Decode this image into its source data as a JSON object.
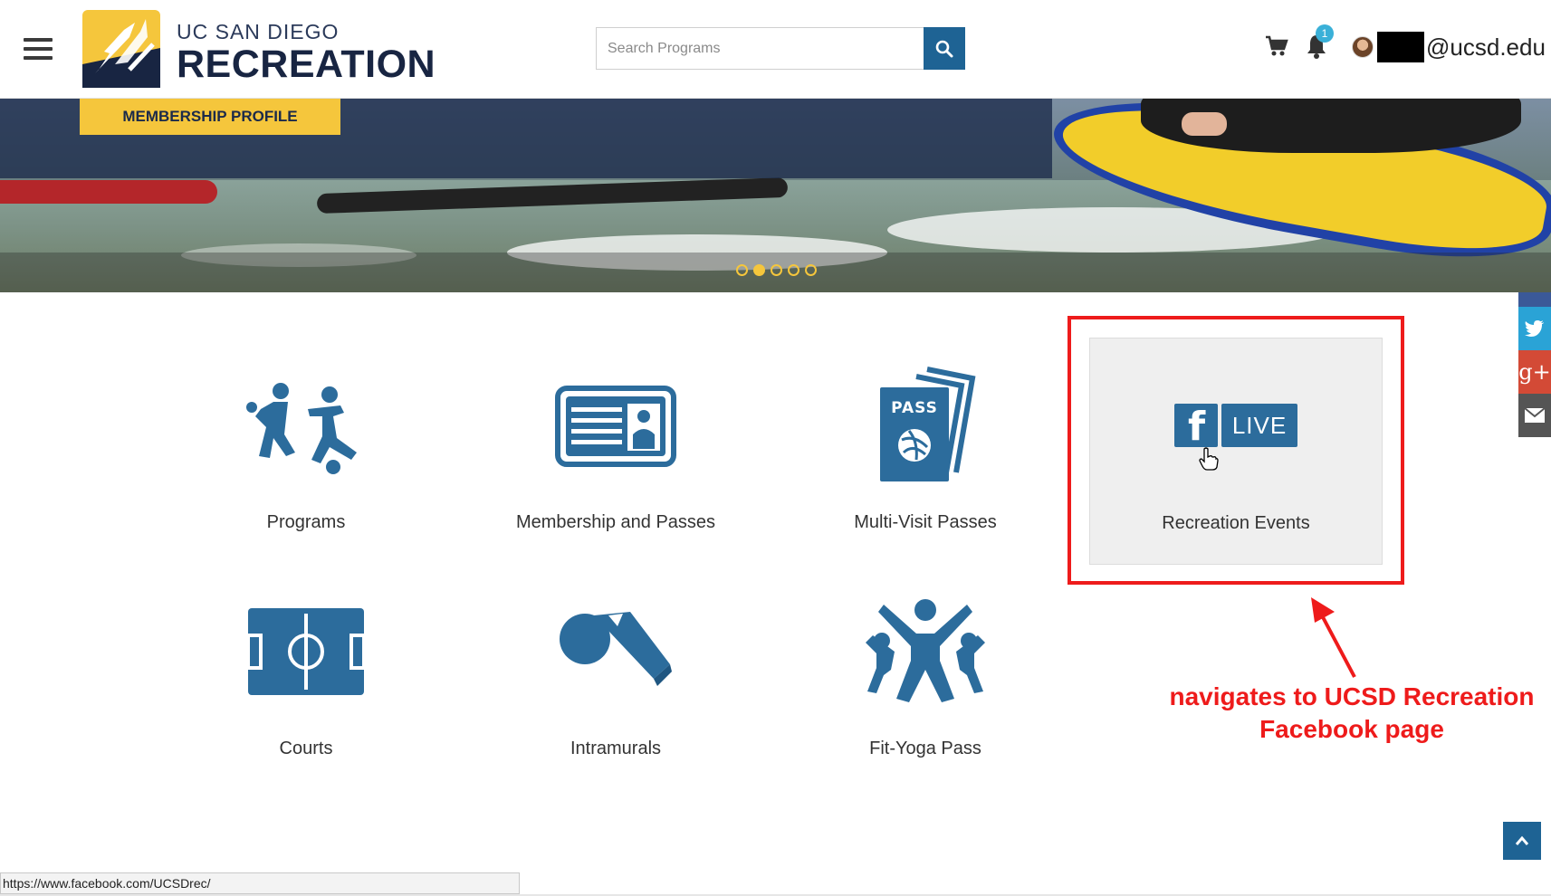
{
  "header": {
    "brand_top": "UC SAN DIEGO",
    "brand_main": "RECREATION",
    "search_placeholder": "Search Programs",
    "notification_count": "1",
    "user_email_suffix": "@ucsd.edu"
  },
  "hero": {
    "membership_button": "MEMBERSHIP PROFILE",
    "carousel_slides": 5,
    "active_slide": 2
  },
  "tiles": [
    {
      "label": "Programs"
    },
    {
      "label": "Membership and Passes"
    },
    {
      "label": "Multi-Visit Passes"
    },
    {
      "label": "Recreation Events"
    },
    {
      "label": "Courts"
    },
    {
      "label": "Intramurals"
    },
    {
      "label": "Fit-Yoga Pass"
    }
  ],
  "pass_icon_text": "PASS",
  "fb_live_text": "LIVE",
  "annotation": {
    "line1": "navigates to UCSD Recreation",
    "line2": "Facebook page"
  },
  "status_bar_url": "https://www.facebook.com/UCSDrec/",
  "colors": {
    "brand_blue": "#1e6394",
    "icon_blue": "#2c6c9c",
    "accent_yellow": "#f5c63c",
    "annotation_red": "#ee1b1b"
  }
}
